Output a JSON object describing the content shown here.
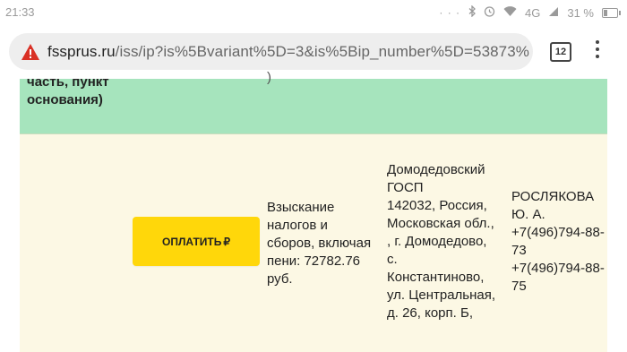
{
  "status_bar": {
    "time": "21:33",
    "dots": "· · ·",
    "network": "4G",
    "battery": "31 %",
    "battery_level": 0.31
  },
  "browser": {
    "url_host": "fssprus.ru",
    "url_path": "/iss/ip?is%5Bvariant%5D=3&is%5Bip_number%5D=53873%",
    "tab_count": "12"
  },
  "table": {
    "header_text": "часть, пункт\nоснования)",
    "header_fragment": ")",
    "row": {
      "pay_label": "ОПЛАТИТЬ",
      "pay_currency": "₽",
      "subject": "Взыскание\nналогов и\nсборов, включая\nпени: 72782.76\nруб.",
      "department": "Домодедовский\nГОСП\n142032, Россия,\nМосковская обл.,\n, г. Домодедово,\nс.\nКонстантиново,\nул. Центральная,\nд. 26, корп. Б,",
      "officer": "РОСЛЯКОВА\nЮ. А.\n+7(496)794-88-\n73\n+7(496)794-88-\n75"
    }
  },
  "colors": {
    "header_bg": "#a6e4bd",
    "row_bg": "#fcf8e4",
    "pay_button": "#ffd70a",
    "warning": "#d93025"
  }
}
